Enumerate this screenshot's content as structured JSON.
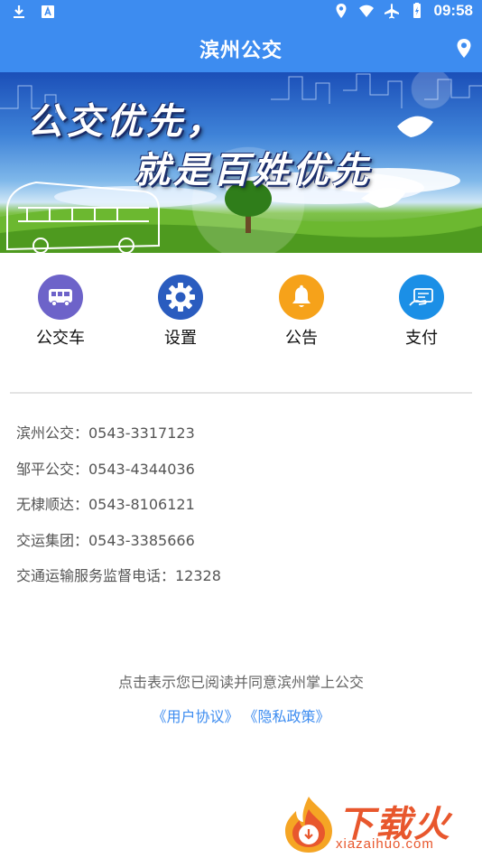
{
  "status_bar": {
    "time": "09:58",
    "left_icons": [
      "download-icon",
      "a-notification-icon"
    ],
    "right_icons": [
      "location-pin-icon",
      "wifi-icon",
      "airplane-icon",
      "battery-icon"
    ]
  },
  "app_bar": {
    "title": "滨州公交",
    "right_icon": "location-pin-icon"
  },
  "banner": {
    "slogan_line1": "公交优先，",
    "slogan_line2": "就是百姓优先"
  },
  "menu": [
    {
      "label": "公交车",
      "icon": "bus-icon",
      "color": "#6d63c9"
    },
    {
      "label": "设置",
      "icon": "gear-icon",
      "color": "#2a5cbf"
    },
    {
      "label": "公告",
      "icon": "bell-icon",
      "color": "#f6a21a"
    },
    {
      "label": "支付",
      "icon": "card-payment-icon",
      "color": "#1b8fe6"
    }
  ],
  "contacts": [
    "滨州公交：0543-3317123",
    "邹平公交：0543-4344036",
    "无棣顺达：0543-8106121",
    "交运集团：0543-3385666",
    "交通运输服务监督电话：12328"
  ],
  "agreement": {
    "text": "点击表示您已阅读并同意滨州掌上公交",
    "user_agreement": "《用户协议》",
    "privacy_policy": "《隐私政策》"
  },
  "watermark": {
    "brand": "下载火",
    "url": "xiazaihuo.com"
  },
  "colors": {
    "primary": "#3d8cf0",
    "link": "#3d8cf0",
    "watermark": "#e8572d"
  }
}
